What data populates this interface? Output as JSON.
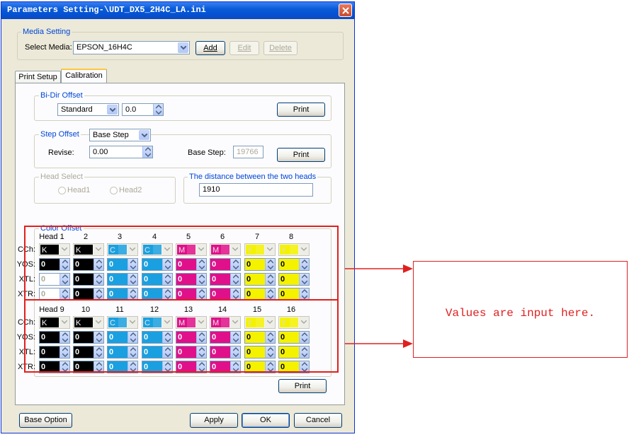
{
  "window": {
    "title": "Parameters Setting-\\UDT_DX5_2H4C_LA.ini"
  },
  "media_setting": {
    "group_label": "Media Setting",
    "select_label": "Select Media:",
    "selected_media": "EPSON_16H4C",
    "add_label": "Add",
    "edit_label": "Edit",
    "delete_label": "Delete"
  },
  "tabs": [
    {
      "label": "Print Setup"
    },
    {
      "label": "Calibration"
    }
  ],
  "bidir": {
    "group_label": "Bi-Dir Offset",
    "mode": "Standard",
    "value": "0.0",
    "print_label": "Print"
  },
  "step": {
    "group_label": "Step Offset",
    "mode": "Base Step",
    "revise_label": "Revise:",
    "revise_value": "0.00",
    "base_step_label": "Base Step:",
    "base_step_value": "19766",
    "print_label": "Print"
  },
  "head_select": {
    "group_label": "Head Select",
    "head1": "Head1",
    "head2": "Head2"
  },
  "distance": {
    "group_label": "The distance between the two heads",
    "value": "1910"
  },
  "color_offset": {
    "group_label": "Color Offset",
    "row_labels": {
      "cch": "CCh:",
      "yos": "YOS:",
      "xtl": "XTL:",
      "xtr": "XTR:"
    },
    "block1_headers": [
      "Head 1",
      "2",
      "3",
      "4",
      "5",
      "6",
      "7",
      "8"
    ],
    "block2_headers": [
      "Head 9",
      "10",
      "11",
      "12",
      "13",
      "14",
      "15",
      "16"
    ],
    "channels": [
      "K",
      "K",
      "C",
      "C",
      "M",
      "M",
      "Y",
      "Y"
    ],
    "channel_colors": [
      "#000000",
      "#000000",
      "#1aa0e0",
      "#1aa0e0",
      "#e0108a",
      "#e0108a",
      "#f5f200",
      "#f5f200"
    ],
    "value": "0",
    "print_label": "Print"
  },
  "footer": {
    "base_option_label": "Base Option",
    "apply_label": "Apply",
    "ok_label": "OK",
    "cancel_label": "Cancel"
  },
  "annotation": {
    "text": "Values are input here."
  }
}
